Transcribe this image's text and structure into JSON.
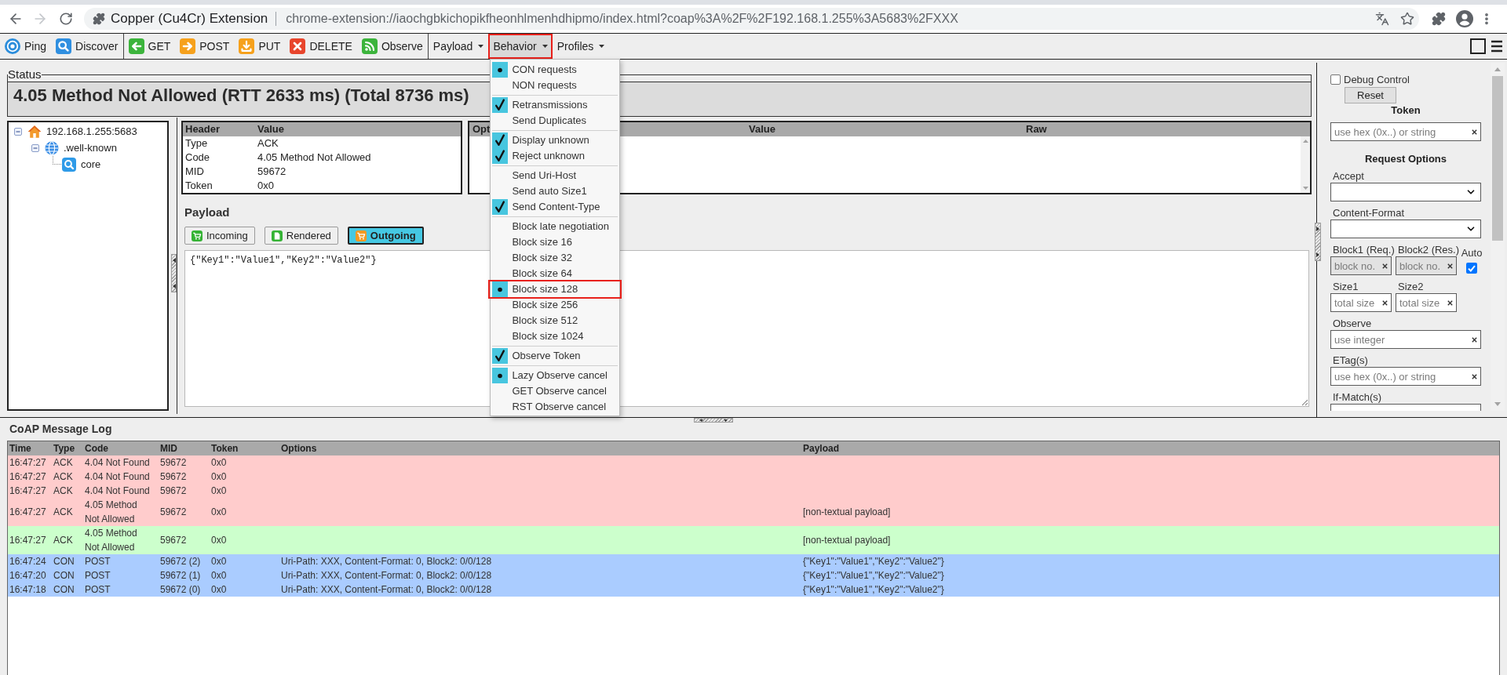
{
  "browser": {
    "back": {
      "disabled": false
    },
    "forward": {
      "disabled": true
    },
    "page_title": "Copper (Cu4Cr) Extension",
    "url": "chrome-extension://iaochgbkichopikfheonhlmenhdhipmo/index.html?coap%3A%2F%2F192.168.1.255%3A5683%2FXXX"
  },
  "toolbar": {
    "action_groups": [
      [
        {
          "label": "Ping",
          "kind": "ping"
        },
        {
          "label": "Discover",
          "kind": "discover"
        }
      ],
      [
        {
          "label": "GET",
          "kind": "get"
        },
        {
          "label": "POST",
          "kind": "post"
        },
        {
          "label": "PUT",
          "kind": "put"
        },
        {
          "label": "DELETE",
          "kind": "delete"
        },
        {
          "label": "Observe",
          "kind": "observe"
        }
      ]
    ],
    "menus": [
      {
        "label": "Payload",
        "open": false,
        "highlighted": false
      },
      {
        "label": "Behavior",
        "open": true,
        "highlighted": true,
        "groups": [
          [
            {
              "label": "CON requests",
              "kind": "radio",
              "selected": true,
              "highlighted": false
            },
            {
              "label": "NON requests",
              "kind": "radio",
              "selected": false,
              "highlighted": false
            }
          ],
          [
            {
              "label": "Retransmissions",
              "kind": "check",
              "checked": true,
              "highlighted": false
            },
            {
              "label": "Send Duplicates",
              "kind": "check",
              "checked": false,
              "highlighted": false
            }
          ],
          [
            {
              "label": "Display unknown",
              "kind": "check",
              "checked": true,
              "highlighted": false
            },
            {
              "label": "Reject unknown",
              "kind": "check",
              "checked": true,
              "highlighted": false
            }
          ],
          [
            {
              "label": "Send Uri-Host",
              "kind": "check",
              "checked": false,
              "highlighted": false
            },
            {
              "label": "Send auto Size1",
              "kind": "check",
              "checked": false,
              "highlighted": false
            },
            {
              "label": "Send Content-Type",
              "kind": "check",
              "checked": true,
              "highlighted": false
            }
          ],
          [
            {
              "label": "Block late negotiation",
              "kind": "check",
              "checked": false,
              "highlighted": false
            },
            {
              "label": "Block size 16",
              "kind": "radio",
              "selected": false,
              "highlighted": false
            },
            {
              "label": "Block size 32",
              "kind": "radio",
              "selected": false,
              "highlighted": false
            },
            {
              "label": "Block size 64",
              "kind": "radio",
              "selected": false,
              "highlighted": false
            },
            {
              "label": "Block size 128",
              "kind": "radio",
              "selected": true,
              "highlighted": true
            },
            {
              "label": "Block size 256",
              "kind": "radio",
              "selected": false,
              "highlighted": false
            },
            {
              "label": "Block size 512",
              "kind": "radio",
              "selected": false,
              "highlighted": false
            },
            {
              "label": "Block size 1024",
              "kind": "radio",
              "selected": false,
              "highlighted": false
            }
          ],
          [
            {
              "label": "Observe Token",
              "kind": "check",
              "checked": true,
              "highlighted": false
            }
          ],
          [
            {
              "label": "Lazy Observe cancel",
              "kind": "radio",
              "selected": true,
              "highlighted": false
            },
            {
              "label": "GET Observe cancel",
              "kind": "radio",
              "selected": false,
              "highlighted": false
            },
            {
              "label": "RST Observe cancel",
              "kind": "radio",
              "selected": false,
              "highlighted": false
            }
          ]
        ]
      },
      {
        "label": "Profiles",
        "open": false,
        "highlighted": false
      }
    ]
  },
  "status": {
    "legend": "Status",
    "text": "4.05 Method Not Allowed (RTT 2633 ms) (Total 8736 ms)"
  },
  "resource_tree": {
    "items": [
      {
        "label": "192.168.1.255:5683",
        "kind": "host",
        "expanded": true,
        "children": [
          {
            "label": ".well-known",
            "kind": "folder",
            "expanded": true,
            "children": [
              {
                "label": "core",
                "kind": "resource"
              }
            ]
          }
        ]
      }
    ]
  },
  "header_table": {
    "columns": [
      "Header",
      "Value"
    ],
    "rows": [
      [
        "Type",
        "ACK"
      ],
      [
        "Code",
        "4.05 Method Not Allowed"
      ],
      [
        "MID",
        "59672"
      ],
      [
        "Token",
        "0x0"
      ]
    ]
  },
  "options_table": {
    "columns": [
      "Opt",
      "Value",
      "Raw"
    ]
  },
  "payload": {
    "title": "Payload",
    "tabs": [
      {
        "label": "Incoming",
        "kind": "incoming",
        "selected": false
      },
      {
        "label": "Rendered",
        "kind": "rendered",
        "selected": false
      },
      {
        "label": "Outgoing",
        "kind": "outgoing",
        "selected": true
      }
    ],
    "text": "{\"Key1\":\"Value1\",\"Key2\":\"Value2\"}"
  },
  "sidebar": {
    "debug_control": {
      "label": "Debug Control",
      "checked": false
    },
    "reset_button": "Reset",
    "token": {
      "title": "Token",
      "placeholder": "use hex (0x..) or string"
    },
    "request_options_title": "Request Options",
    "fields": [
      {
        "kind": "select",
        "label": "Accept"
      },
      {
        "kind": "select",
        "label": "Content-Format"
      },
      {
        "kind": "pair",
        "items": [
          {
            "label": "Block1 (Req.)",
            "placeholder": "block no.",
            "disabled": true
          },
          {
            "label": "Block2 (Res.)",
            "placeholder": "block no.",
            "disabled": true
          }
        ],
        "auto": {
          "label": "Auto",
          "checked": true
        }
      },
      {
        "kind": "pair",
        "items": [
          {
            "label": "Size1",
            "placeholder": "total size",
            "disabled": false
          },
          {
            "label": "Size2",
            "placeholder": "total size",
            "disabled": false
          }
        ]
      },
      {
        "kind": "text",
        "label": "Observe",
        "placeholder": "use integer"
      },
      {
        "kind": "text",
        "label": "ETag(s)",
        "placeholder": "use hex (0x..) or string"
      },
      {
        "kind": "text_partial",
        "label": "If-Match(s)"
      }
    ]
  },
  "log": {
    "title": "CoAP Message Log",
    "columns": [
      "Time",
      "Type",
      "Code",
      "MID",
      "Token",
      "Options",
      "Payload"
    ],
    "rows": [
      {
        "time": "16:47:27",
        "type": "ACK",
        "code": "4.04 Not Found",
        "mid": "59672",
        "token": "0x0",
        "color": "#ffcccc"
      },
      {
        "time": "16:47:27",
        "type": "ACK",
        "code": "4.04 Not Found",
        "mid": "59672",
        "token": "0x0",
        "color": "#ffcccc"
      },
      {
        "time": "16:47:27",
        "type": "ACK",
        "code": "4.04 Not Found",
        "mid": "59672",
        "token": "0x0",
        "color": "#ffcccc"
      },
      {
        "time": "16:47:27",
        "type": "ACK",
        "code": "4.05 Method Not Allowed",
        "mid": "59672",
        "token": "0x0",
        "payload": "[non-textual payload]",
        "color": "#ffcccc"
      },
      {
        "time": "16:47:27",
        "type": "ACK",
        "code": "4.05 Method Not Allowed",
        "mid": "59672",
        "token": "0x0",
        "payload": "[non-textual payload]",
        "color": "#ccffcc"
      },
      {
        "time": "16:47:24",
        "type": "CON",
        "code": "POST",
        "mid": "59672 (2)",
        "token": "0x0",
        "options": "Uri-Path: XXX, Content-Format: 0, Block2: 0/0/128",
        "payload": "{\"Key1\":\"Value1\",\"Key2\":\"Value2\"}",
        "color": "#aaccff"
      },
      {
        "time": "16:47:20",
        "type": "CON",
        "code": "POST",
        "mid": "59672 (1)",
        "token": "0x0",
        "options": "Uri-Path: XXX, Content-Format: 0, Block2: 0/0/128",
        "payload": "{\"Key1\":\"Value1\",\"Key2\":\"Value2\"}",
        "color": "#aaccff"
      },
      {
        "time": "16:47:18",
        "type": "CON",
        "code": "POST",
        "mid": "59672 (0)",
        "token": "0x0",
        "options": "Uri-Path: XXX, Content-Format: 0, Block2: 0/0/128",
        "payload": "{\"Key1\":\"Value1\",\"Key2\":\"Value2\"}",
        "color": "#aaccff"
      }
    ]
  }
}
